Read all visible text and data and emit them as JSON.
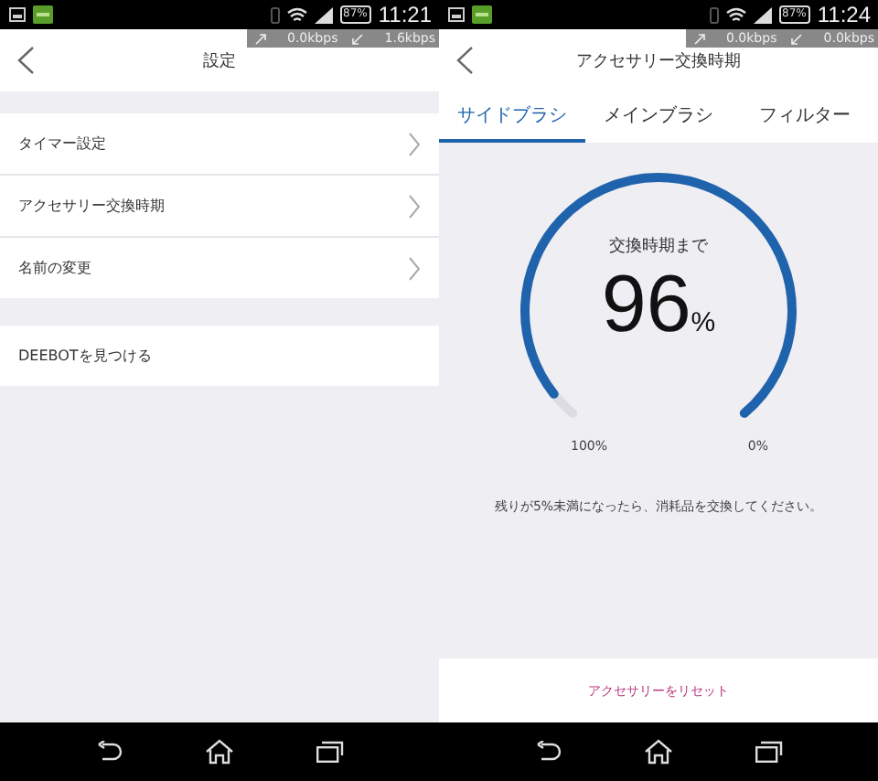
{
  "screens": [
    {
      "kind": "settings",
      "status_bar": {
        "battery": "87%",
        "time": "11:21",
        "upload": "0.0kbps",
        "download": "1.6kbps"
      },
      "header": {
        "title": "設定"
      },
      "sections": [
        {
          "items": [
            {
              "label": "タイマー設定",
              "chevron": true
            },
            {
              "label": "アクセサリー交換時期",
              "chevron": true
            },
            {
              "label": "名前の変更",
              "chevron": true
            }
          ]
        },
        {
          "items": [
            {
              "label": "DEEBOTを見つける",
              "chevron": false
            }
          ]
        }
      ]
    },
    {
      "kind": "accessory",
      "status_bar": {
        "battery": "87%",
        "time": "11:24",
        "upload": "0.0kbps",
        "download": "0.0kbps"
      },
      "header": {
        "title": "アクセサリー交換時期"
      },
      "tabs": [
        {
          "label": "サイドブラシ",
          "selected": true
        },
        {
          "label": "メインブラシ",
          "selected": false
        },
        {
          "label": "フィルター",
          "selected": false
        }
      ],
      "gauge": {
        "caption": "交換時期まで",
        "value": "96",
        "unit": "%",
        "level": 0.96,
        "start_label": "100%",
        "end_label": "0%"
      },
      "note": "残りが5%未満になったら、消耗品を交換してください。",
      "reset_link": "アクセサリーをリセット"
    }
  ]
}
